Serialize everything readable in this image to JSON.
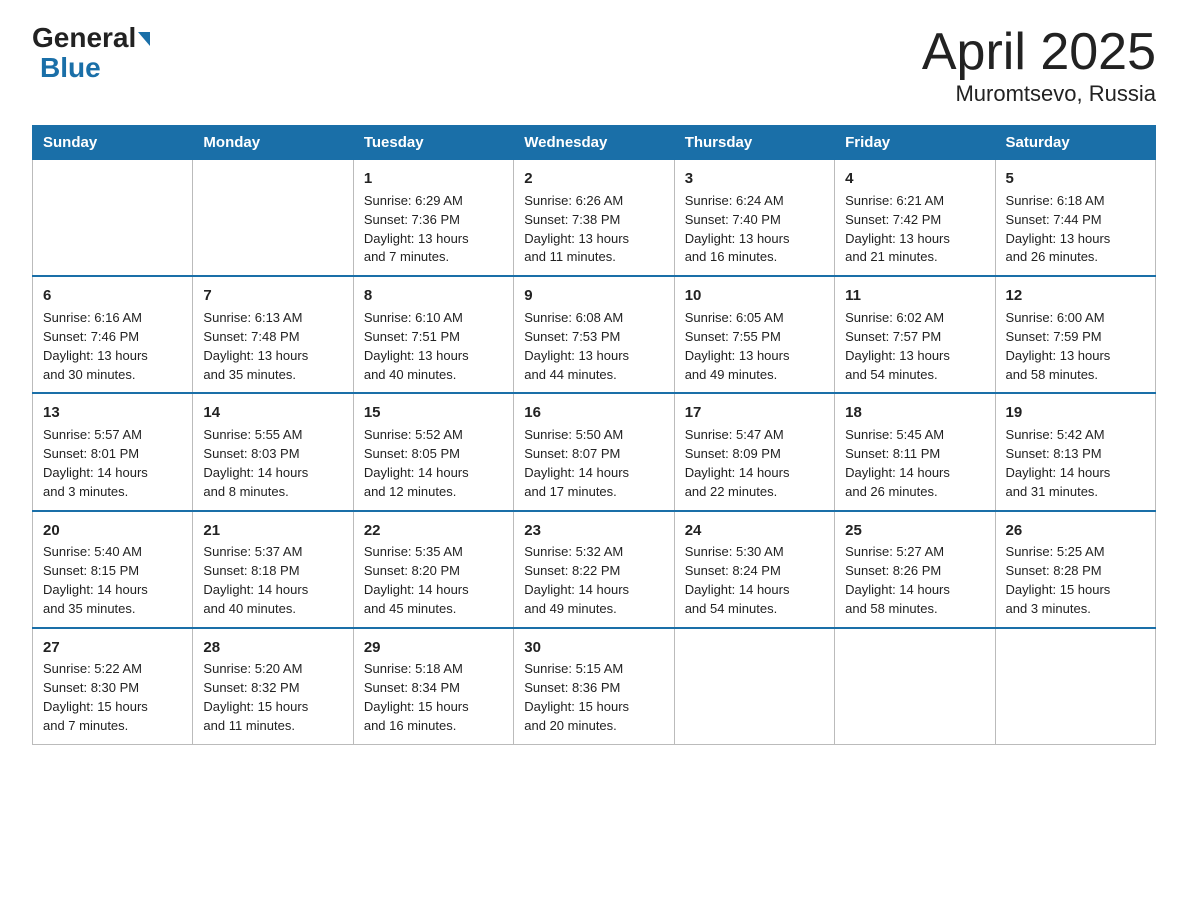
{
  "logo": {
    "general": "General",
    "blue": "Blue"
  },
  "header": {
    "title": "April 2025",
    "subtitle": "Muromtsevo, Russia"
  },
  "weekdays": [
    "Sunday",
    "Monday",
    "Tuesday",
    "Wednesday",
    "Thursday",
    "Friday",
    "Saturday"
  ],
  "weeks": [
    [
      {
        "day": "",
        "info": ""
      },
      {
        "day": "",
        "info": ""
      },
      {
        "day": "1",
        "info": "Sunrise: 6:29 AM\nSunset: 7:36 PM\nDaylight: 13 hours\nand 7 minutes."
      },
      {
        "day": "2",
        "info": "Sunrise: 6:26 AM\nSunset: 7:38 PM\nDaylight: 13 hours\nand 11 minutes."
      },
      {
        "day": "3",
        "info": "Sunrise: 6:24 AM\nSunset: 7:40 PM\nDaylight: 13 hours\nand 16 minutes."
      },
      {
        "day": "4",
        "info": "Sunrise: 6:21 AM\nSunset: 7:42 PM\nDaylight: 13 hours\nand 21 minutes."
      },
      {
        "day": "5",
        "info": "Sunrise: 6:18 AM\nSunset: 7:44 PM\nDaylight: 13 hours\nand 26 minutes."
      }
    ],
    [
      {
        "day": "6",
        "info": "Sunrise: 6:16 AM\nSunset: 7:46 PM\nDaylight: 13 hours\nand 30 minutes."
      },
      {
        "day": "7",
        "info": "Sunrise: 6:13 AM\nSunset: 7:48 PM\nDaylight: 13 hours\nand 35 minutes."
      },
      {
        "day": "8",
        "info": "Sunrise: 6:10 AM\nSunset: 7:51 PM\nDaylight: 13 hours\nand 40 minutes."
      },
      {
        "day": "9",
        "info": "Sunrise: 6:08 AM\nSunset: 7:53 PM\nDaylight: 13 hours\nand 44 minutes."
      },
      {
        "day": "10",
        "info": "Sunrise: 6:05 AM\nSunset: 7:55 PM\nDaylight: 13 hours\nand 49 minutes."
      },
      {
        "day": "11",
        "info": "Sunrise: 6:02 AM\nSunset: 7:57 PM\nDaylight: 13 hours\nand 54 minutes."
      },
      {
        "day": "12",
        "info": "Sunrise: 6:00 AM\nSunset: 7:59 PM\nDaylight: 13 hours\nand 58 minutes."
      }
    ],
    [
      {
        "day": "13",
        "info": "Sunrise: 5:57 AM\nSunset: 8:01 PM\nDaylight: 14 hours\nand 3 minutes."
      },
      {
        "day": "14",
        "info": "Sunrise: 5:55 AM\nSunset: 8:03 PM\nDaylight: 14 hours\nand 8 minutes."
      },
      {
        "day": "15",
        "info": "Sunrise: 5:52 AM\nSunset: 8:05 PM\nDaylight: 14 hours\nand 12 minutes."
      },
      {
        "day": "16",
        "info": "Sunrise: 5:50 AM\nSunset: 8:07 PM\nDaylight: 14 hours\nand 17 minutes."
      },
      {
        "day": "17",
        "info": "Sunrise: 5:47 AM\nSunset: 8:09 PM\nDaylight: 14 hours\nand 22 minutes."
      },
      {
        "day": "18",
        "info": "Sunrise: 5:45 AM\nSunset: 8:11 PM\nDaylight: 14 hours\nand 26 minutes."
      },
      {
        "day": "19",
        "info": "Sunrise: 5:42 AM\nSunset: 8:13 PM\nDaylight: 14 hours\nand 31 minutes."
      }
    ],
    [
      {
        "day": "20",
        "info": "Sunrise: 5:40 AM\nSunset: 8:15 PM\nDaylight: 14 hours\nand 35 minutes."
      },
      {
        "day": "21",
        "info": "Sunrise: 5:37 AM\nSunset: 8:18 PM\nDaylight: 14 hours\nand 40 minutes."
      },
      {
        "day": "22",
        "info": "Sunrise: 5:35 AM\nSunset: 8:20 PM\nDaylight: 14 hours\nand 45 minutes."
      },
      {
        "day": "23",
        "info": "Sunrise: 5:32 AM\nSunset: 8:22 PM\nDaylight: 14 hours\nand 49 minutes."
      },
      {
        "day": "24",
        "info": "Sunrise: 5:30 AM\nSunset: 8:24 PM\nDaylight: 14 hours\nand 54 minutes."
      },
      {
        "day": "25",
        "info": "Sunrise: 5:27 AM\nSunset: 8:26 PM\nDaylight: 14 hours\nand 58 minutes."
      },
      {
        "day": "26",
        "info": "Sunrise: 5:25 AM\nSunset: 8:28 PM\nDaylight: 15 hours\nand 3 minutes."
      }
    ],
    [
      {
        "day": "27",
        "info": "Sunrise: 5:22 AM\nSunset: 8:30 PM\nDaylight: 15 hours\nand 7 minutes."
      },
      {
        "day": "28",
        "info": "Sunrise: 5:20 AM\nSunset: 8:32 PM\nDaylight: 15 hours\nand 11 minutes."
      },
      {
        "day": "29",
        "info": "Sunrise: 5:18 AM\nSunset: 8:34 PM\nDaylight: 15 hours\nand 16 minutes."
      },
      {
        "day": "30",
        "info": "Sunrise: 5:15 AM\nSunset: 8:36 PM\nDaylight: 15 hours\nand 20 minutes."
      },
      {
        "day": "",
        "info": ""
      },
      {
        "day": "",
        "info": ""
      },
      {
        "day": "",
        "info": ""
      }
    ]
  ]
}
